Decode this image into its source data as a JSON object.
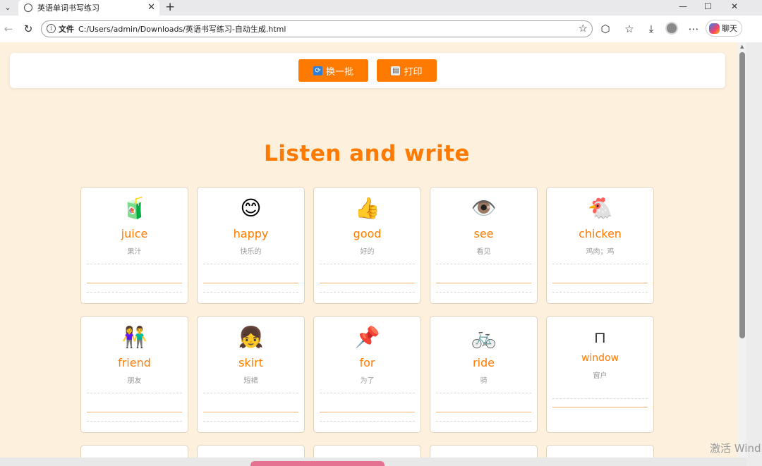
{
  "browser": {
    "tab_title": "英语单词书写练习",
    "address_label": "文件",
    "url": "C:/Users/admin/Downloads/英语书写练习-自动生成.html",
    "copilot_label": "聊天"
  },
  "toolbar": {
    "refresh_label": "换一批",
    "print_label": "打印"
  },
  "heading": "Listen and write",
  "cards": [
    {
      "icon": "🧃",
      "word": "juice",
      "meaning": "果汁"
    },
    {
      "icon": "😊",
      "word": "happy",
      "meaning": "快乐的"
    },
    {
      "icon": "👍",
      "word": "good",
      "meaning": "好的"
    },
    {
      "icon": "👁️",
      "word": "see",
      "meaning": "看见"
    },
    {
      "icon": "🐔",
      "word": "chicken",
      "meaning": "鸡肉；鸡"
    },
    {
      "icon": "👫",
      "word": "friend",
      "meaning": "朋友"
    },
    {
      "icon": "👧",
      "word": "skirt",
      "meaning": "短裙"
    },
    {
      "icon": "📌",
      "word": "for",
      "meaning": "为了"
    },
    {
      "icon": "🚲",
      "word": "ride",
      "meaning": "骑"
    },
    {
      "icon": "⊓",
      "word": "window",
      "meaning": "窗户"
    }
  ],
  "watermark": "激活 Wind"
}
